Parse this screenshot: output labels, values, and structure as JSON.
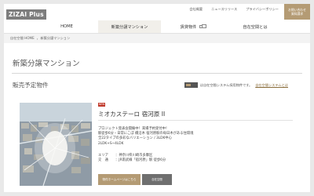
{
  "header": {
    "logo": "ZIZAI Plus",
    "top_links": [
      "会社概要",
      "ニュースリリース",
      "プライバシーポリシー"
    ],
    "contact": [
      "お問い合わせ",
      "資料請求"
    ]
  },
  "nav": {
    "items": [
      {
        "label": "HOME"
      },
      {
        "label": "新築分譲マンション"
      },
      {
        "label": "賃貸物件"
      },
      {
        "label": "自在空間とは"
      }
    ]
  },
  "breadcrumb": [
    "自在空間 HOME",
    "新築分譲マンション"
  ],
  "page": {
    "title": "新築分譲マンション",
    "section": "販売予定物件",
    "system_note": "は自在空間システム採用物件です。",
    "system_link": "自在空間システムとは"
  },
  "property": {
    "badge": "NEW",
    "name": "ミオカステーロ 宿河原 II",
    "desc_lines": [
      "プロジェクト発表会開催中！来場予約受付中！",
      "駅徒歩6分・日常にこぼ 橋沿木 宿河原駅の毎日木がある住環境",
      "全22タイプの多彩なバリエーション / 3LDK中心",
      "2LDK+S~4LDK"
    ],
    "info": [
      {
        "k": "エリア",
        "v": "神奈川県川崎市多摩区"
      },
      {
        "k": "交　通",
        "v": "JR南武線「宿河原」駅 徒歩6分"
      }
    ],
    "detail_button": "物件ホームページはこちら",
    "tag": "自在空間"
  },
  "colors": {
    "accent": "#b49b74",
    "badge_red": "#c0392b",
    "nav_active": "#f1efea"
  }
}
